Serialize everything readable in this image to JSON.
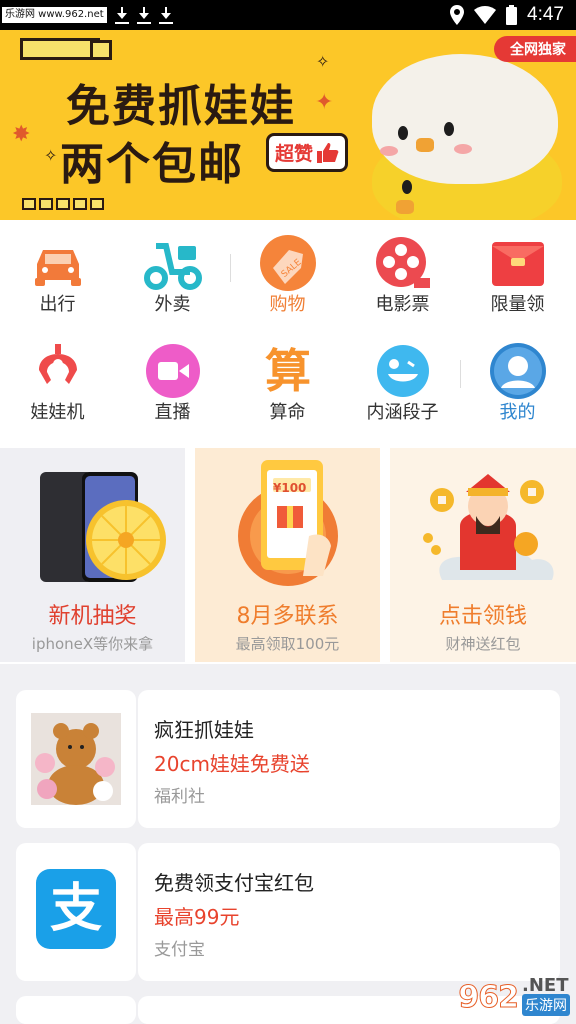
{
  "status_bar": {
    "watermark_text": "乐游网 www.962.net",
    "time": "4:47",
    "icons": [
      "download-icon",
      "download-icon",
      "download-icon",
      "location-icon",
      "wifi-icon",
      "battery-icon"
    ]
  },
  "banner": {
    "badge": "全网独家",
    "line1": "免费抓娃娃",
    "line2": "两个包邮",
    "tag": "超赞"
  },
  "nav": {
    "items": [
      {
        "label": "出行",
        "icon": "car-icon"
      },
      {
        "label": "外卖",
        "icon": "scooter-icon"
      },
      {
        "label": "购物",
        "icon": "sale-tag-icon",
        "active": true
      },
      {
        "label": "电影票",
        "icon": "film-reel-icon"
      },
      {
        "label": "限量领",
        "icon": "red-envelope-icon"
      },
      {
        "label": "娃娃机",
        "icon": "claw-icon"
      },
      {
        "label": "直播",
        "icon": "video-camera-icon"
      },
      {
        "label": "算命",
        "icon": "fortune-character-icon",
        "glyph": "算"
      },
      {
        "label": "内涵段子",
        "icon": "smiley-icon"
      },
      {
        "label": "我的",
        "icon": "user-avatar-icon"
      }
    ]
  },
  "promos": [
    {
      "title": "新机抽奖",
      "subtitle": "iphoneX等你来拿",
      "title_color": "#e0412f",
      "bg": "#efeff3"
    },
    {
      "title": "8月多联系",
      "subtitle": "最高领取100元",
      "title_color": "#ef7d2d",
      "bg": "#fdebd4",
      "phone_label": "¥100"
    },
    {
      "title": "点击领钱",
      "subtitle": "财神送红包",
      "title_color": "#ef7d2d",
      "bg": "#fdf3e6"
    }
  ],
  "list": [
    {
      "title": "疯狂抓娃娃",
      "highlight": "20cm娃娃免费送",
      "source": "福利社",
      "thumb": "plush-toys-image"
    },
    {
      "title": "免费领支付宝红包",
      "highlight": "最高99元",
      "source": "支付宝",
      "thumb": "alipay-logo",
      "logo_glyph": "支"
    }
  ],
  "watermark": {
    "logo": "962",
    "net": ".NET",
    "cn": "乐游网"
  },
  "colors": {
    "banner_bg": "#fcc728",
    "accent_orange": "#f07f35",
    "accent_red": "#e8432d",
    "mine_blue": "#2f86cf",
    "alipay_blue": "#1aa0e8"
  }
}
